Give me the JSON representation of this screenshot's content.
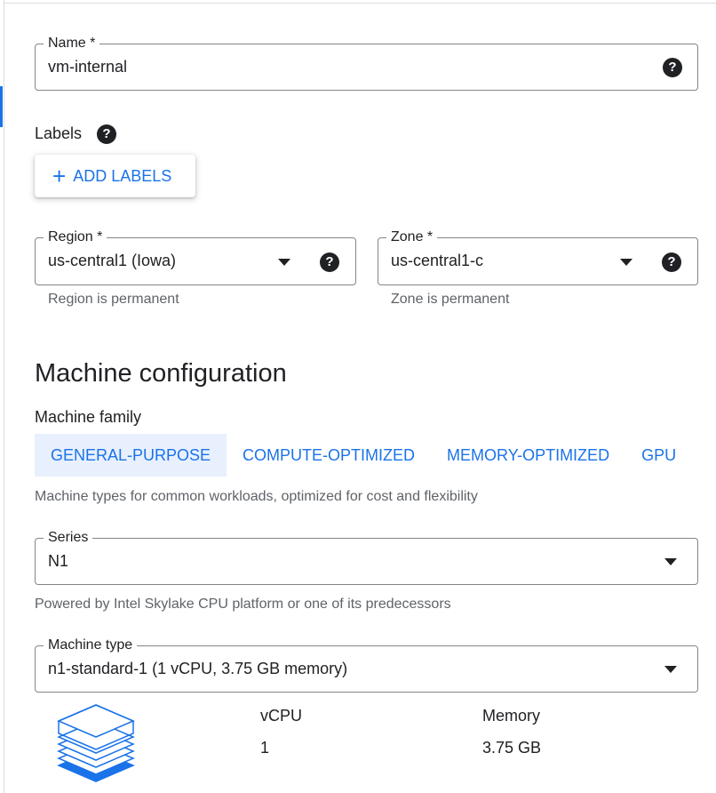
{
  "name_field": {
    "label": "Name *",
    "value": "vm-internal"
  },
  "labels": {
    "heading": "Labels",
    "add_button": "ADD LABELS"
  },
  "region": {
    "label": "Region *",
    "value": "us-central1 (Iowa)",
    "hint": "Region is permanent"
  },
  "zone": {
    "label": "Zone *",
    "value": "us-central1-c",
    "hint": "Zone is permanent"
  },
  "machine": {
    "title": "Machine configuration",
    "family_label": "Machine family",
    "tabs": [
      {
        "label": "GENERAL-PURPOSE",
        "active": true
      },
      {
        "label": "COMPUTE-OPTIMIZED",
        "active": false
      },
      {
        "label": "MEMORY-OPTIMIZED",
        "active": false
      },
      {
        "label": "GPU",
        "active": false
      }
    ],
    "family_description": "Machine types for common workloads, optimized for cost and flexibility",
    "series": {
      "label": "Series",
      "value": "N1",
      "hint": "Powered by Intel Skylake CPU platform or one of its predecessors"
    },
    "type": {
      "label": "Machine type",
      "value": "n1-standard-1 (1 vCPU, 3.75 GB memory)"
    },
    "specs": {
      "vcpu_label": "vCPU",
      "vcpu_value": "1",
      "memory_label": "Memory",
      "memory_value": "3.75 GB"
    }
  },
  "colors": {
    "accent": "#1a73e8",
    "active_tab_bg": "#e8f0fe",
    "border": "#80868b",
    "hint": "#5f6368"
  }
}
